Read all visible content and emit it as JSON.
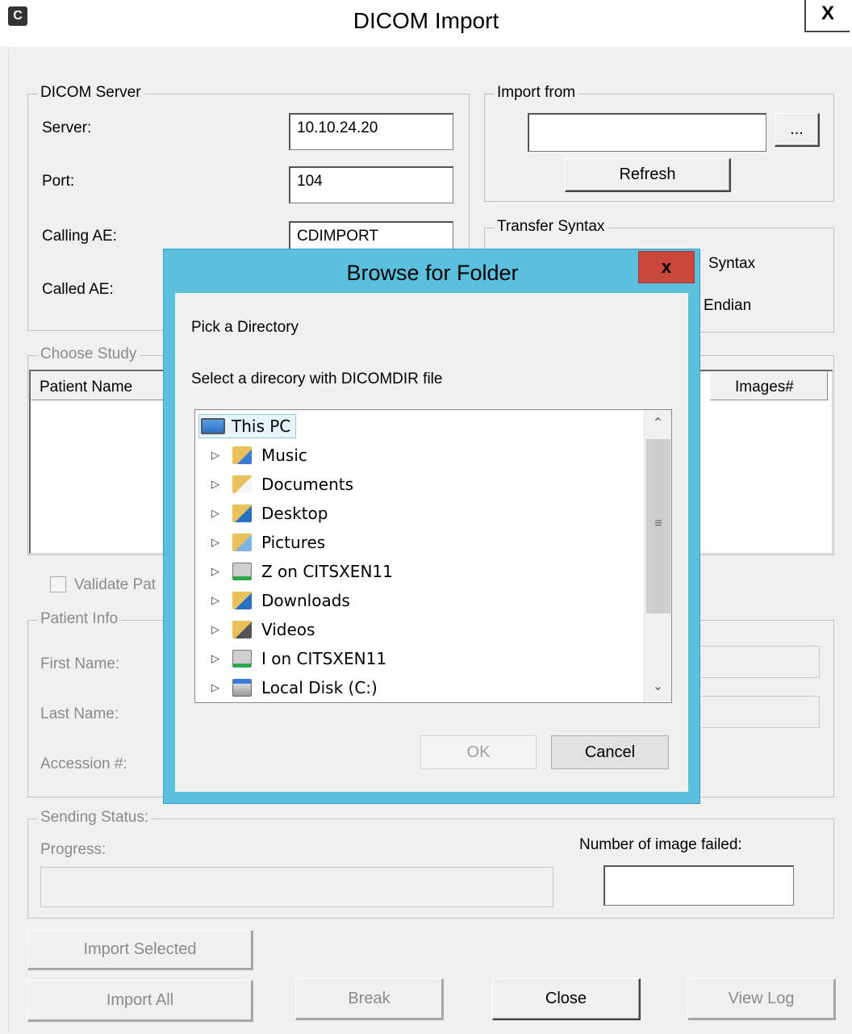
{
  "window": {
    "title": "DICOM Import",
    "app_icon_glyph": "C",
    "close_glyph": "X"
  },
  "dicom_server": {
    "legend": "DICOM Server",
    "server_label": "Server:",
    "server_value": "10.10.24.20",
    "port_label": "Port:",
    "port_value": "104",
    "calling_ae_label": "Calling AE:",
    "calling_ae_value": "CDIMPORT",
    "called_ae_label": "Called AE:"
  },
  "import_from": {
    "legend": "Import from",
    "path_value": "",
    "browse_label": "...",
    "refresh_label": "Refresh"
  },
  "transfer_syntax": {
    "legend": "Transfer Syntax",
    "option1_partial": "Syntax",
    "option2_partial": "Endian"
  },
  "choose_study": {
    "legend": "Choose Study",
    "columns": [
      "Patient Name",
      "Images#"
    ]
  },
  "validate": {
    "label": "Validate Pat"
  },
  "patient_info": {
    "legend": "Patient Info",
    "first_name_label": "First Name:",
    "last_name_label": "Last Name:",
    "accession_label": "Accession #:"
  },
  "sending_status": {
    "legend": "Sending Status:",
    "progress_label": "Progress:",
    "failed_label": "Number of image failed:"
  },
  "buttons": {
    "import_selected": "Import Selected",
    "import_all": "Import All",
    "break": "Break",
    "close": "Close",
    "view_log": "View Log"
  },
  "browse_dialog": {
    "title": "Browse for Folder",
    "close_glyph": "x",
    "heading": "Pick a Directory",
    "instruction": "Select a direcory with DICOMDIR file",
    "tree": [
      {
        "label": "This PC",
        "icon": "this-pc-icon",
        "selected": true
      },
      {
        "label": "Music",
        "icon": "music-folder-icon"
      },
      {
        "label": "Documents",
        "icon": "documents-folder-icon"
      },
      {
        "label": "Desktop",
        "icon": "desktop-folder-icon"
      },
      {
        "label": "Pictures",
        "icon": "pictures-folder-icon"
      },
      {
        "label": "Z on CITSXEN11",
        "icon": "network-drive-icon"
      },
      {
        "label": "Downloads",
        "icon": "downloads-folder-icon"
      },
      {
        "label": "Videos",
        "icon": "videos-folder-icon"
      },
      {
        "label": "I on CITSXEN11",
        "icon": "network-drive-icon"
      },
      {
        "label": "Local Disk (C:)",
        "icon": "local-disk-icon"
      }
    ],
    "ok_label": "OK",
    "cancel_label": "Cancel"
  },
  "colors": {
    "dialog_frame": "#5bc0de",
    "dialog_close": "#c9483c",
    "window_bg": "#f0f0f0"
  }
}
